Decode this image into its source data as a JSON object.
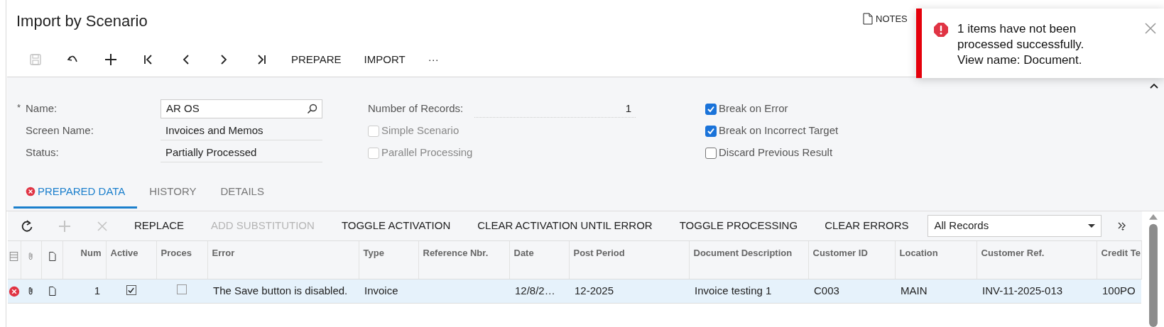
{
  "page": {
    "title": "Import by Scenario"
  },
  "toolbar": {
    "icons": [
      {
        "kind": "save",
        "disabled": true
      },
      {
        "kind": "undo",
        "disabled": false
      },
      {
        "kind": "add",
        "disabled": false
      },
      {
        "kind": "first",
        "disabled": false
      },
      {
        "kind": "prev",
        "disabled": false
      },
      {
        "kind": "next",
        "disabled": false
      },
      {
        "kind": "last",
        "disabled": false
      }
    ],
    "buttons": [
      {
        "label": "PREPARE"
      },
      {
        "label": "IMPORT"
      },
      {
        "label": "···"
      }
    ]
  },
  "notes": {
    "label": "NOTES"
  },
  "notification": {
    "message": "1 items have not been\nprocessed successfully.\nView name: Document."
  },
  "form": {
    "fields": [
      {
        "label": "Name:",
        "required_mark": "*",
        "value": "AR OS",
        "kind": "lookup"
      },
      {
        "label": "Screen Name:",
        "value": "Invoices and Memos",
        "kind": "text"
      },
      {
        "label": "Status:",
        "value": "Partially Processed",
        "kind": "text"
      }
    ],
    "number_of_records": {
      "label": "Number of Records:",
      "value": "1"
    },
    "options": [
      {
        "label": "Simple Scenario",
        "checked": false,
        "disabled": true
      },
      {
        "label": "Parallel Processing",
        "checked": false,
        "disabled": true
      }
    ],
    "flags": [
      {
        "label": "Break on Error",
        "checked": true,
        "disabled": false
      },
      {
        "label": "Break on Incorrect Target",
        "checked": true,
        "disabled": false
      },
      {
        "label": "Discard Previous Result",
        "checked": false,
        "disabled": false
      }
    ]
  },
  "tabs": [
    {
      "label": "PREPARED DATA",
      "selected": true,
      "error": true
    },
    {
      "label": "HISTORY",
      "selected": false,
      "error": false
    },
    {
      "label": "DETAILS",
      "selected": false,
      "error": false
    }
  ],
  "grid_toolbar": {
    "icons": [
      {
        "kind": "refresh",
        "disabled": false
      },
      {
        "kind": "add",
        "disabled": true
      },
      {
        "kind": "delete",
        "disabled": true
      }
    ],
    "buttons": [
      {
        "label": "REPLACE",
        "disabled": false
      },
      {
        "label": "ADD SUBSTITUTION",
        "disabled": true
      },
      {
        "label": "TOGGLE ACTIVATION",
        "disabled": false
      },
      {
        "label": "CLEAR ACTIVATION UNTIL ERROR",
        "disabled": false
      },
      {
        "label": "TOGGLE PROCESSING",
        "disabled": false
      },
      {
        "label": "CLEAR ERRORS",
        "disabled": false
      }
    ],
    "filter": {
      "value": "All Records"
    }
  },
  "table": {
    "columns": [
      {
        "kind": "status"
      },
      {
        "kind": "files"
      },
      {
        "kind": "notes"
      },
      {
        "label": "Num"
      },
      {
        "label": "Active"
      },
      {
        "label": "Proces"
      },
      {
        "label": "Error"
      },
      {
        "label": "Type"
      },
      {
        "label": "Reference Nbr."
      },
      {
        "label": "Date"
      },
      {
        "label": "Post Period"
      },
      {
        "label": "Document Description"
      },
      {
        "label": "Customer ID"
      },
      {
        "label": "Location"
      },
      {
        "label": "Customer Ref."
      },
      {
        "label": "Credit Te"
      }
    ],
    "rows": [
      {
        "selected": true,
        "error": true,
        "num": "1",
        "active": true,
        "processed": false,
        "error_text": "The Save button is disabled.",
        "type": "Invoice",
        "date": "12/8/2…",
        "post_period": "12-2025",
        "document_description": "Invoice testing 1",
        "customer_id": "C003",
        "location": "MAIN",
        "customer_ref": "INV-11-2025-013",
        "credit_terms": "100PO"
      }
    ]
  }
}
